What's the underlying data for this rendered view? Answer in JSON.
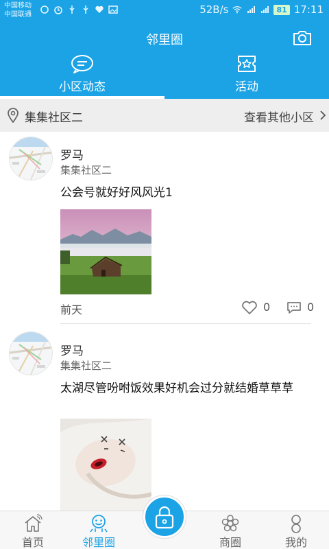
{
  "status_bar": {
    "carrier_1": "中国移动",
    "carrier_2": "中国联通",
    "net_speed": "52B/s",
    "battery": "81",
    "time": "17:11"
  },
  "header": {
    "title": "邻里圈",
    "tabs": [
      {
        "label": "小区动态",
        "icon": "chat-bubble-icon",
        "active": true
      },
      {
        "label": "活动",
        "icon": "star-ticket-icon",
        "active": false
      }
    ]
  },
  "community_bar": {
    "name": "集集社区二",
    "other_link": "查看其他小区"
  },
  "posts": [
    {
      "author": "罗马",
      "community": "集集社区二",
      "text": "公会号就好好风风光1",
      "time": "前天",
      "likes": "0",
      "comments": "0"
    },
    {
      "author": "罗马",
      "community": "集集社区二",
      "text": "太湖尽管吩咐饭效果好机会过分就结婚草草草"
    }
  ],
  "bottom_nav": [
    {
      "label": "首页",
      "icon": "home-icon",
      "active": false
    },
    {
      "label": "邻里圈",
      "icon": "neighbor-circle-icon",
      "active": true
    },
    {
      "label": "",
      "icon": "lock-icon",
      "active": false
    },
    {
      "label": "商圈",
      "icon": "flower-shop-icon",
      "active": false
    },
    {
      "label": "我的",
      "icon": "person-icon",
      "active": false
    }
  ],
  "colors": {
    "primary": "#1ba3e6",
    "background": "#ffffff",
    "bar_gray": "#eeeeee"
  }
}
